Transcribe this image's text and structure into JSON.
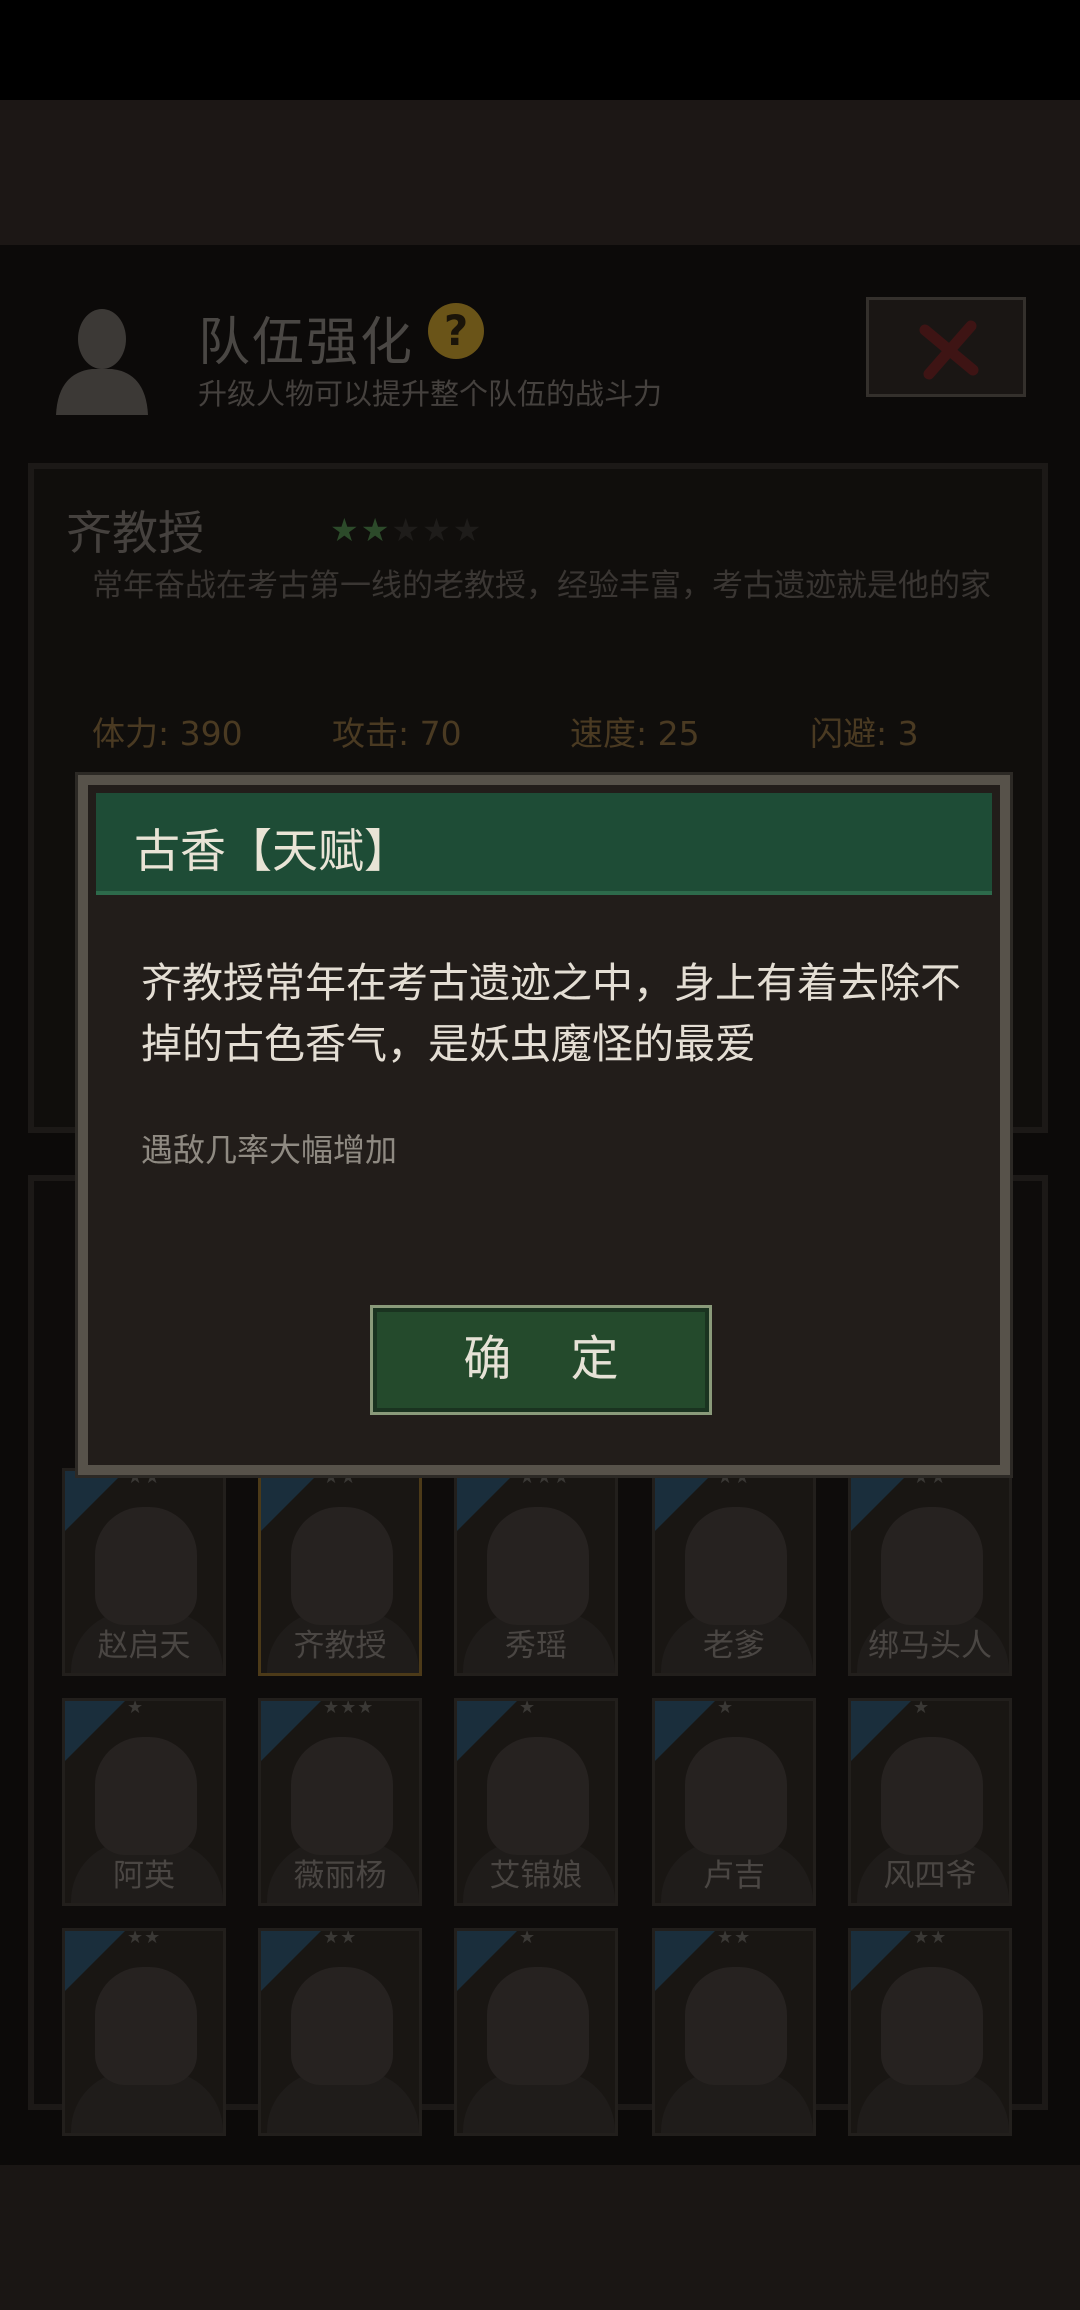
{
  "header": {
    "title": "队伍强化",
    "subtitle": "升级人物可以提升整个队伍的战斗力"
  },
  "character": {
    "name": "齐教授",
    "stars_filled": 2,
    "stars_total": 5,
    "description": "常年奋战在考古第一线的老教授，经验丰富，考古遗迹就是他的家",
    "stats": {
      "hp": "体力: 390",
      "attack": "攻击: 70",
      "speed": "速度: 25",
      "dodge": "闪避: 3"
    }
  },
  "modal": {
    "title": "古香【天赋】",
    "body": "齐教授常年在考古遗迹之中，身上有着去除不掉的古色香气，是妖虫魔怪的最爱",
    "effect": "遇敌几率大幅增加",
    "confirm_label": "确 定"
  },
  "roster": [
    {
      "name": "赵启天",
      "stars": "★★",
      "selected": false
    },
    {
      "name": "齐教授",
      "stars": "★★",
      "selected": true
    },
    {
      "name": "秀瑶",
      "stars": "★★★",
      "selected": false
    },
    {
      "name": "老爹",
      "stars": "★★",
      "selected": false
    },
    {
      "name": "绑马头人",
      "stars": "★★",
      "selected": false
    },
    {
      "name": "阿英",
      "stars": "★",
      "selected": false
    },
    {
      "name": "薇丽杨",
      "stars": "★★★",
      "selected": false
    },
    {
      "name": "艾锦娘",
      "stars": "★",
      "selected": false
    },
    {
      "name": "卢吉",
      "stars": "★",
      "selected": false
    },
    {
      "name": "风四爷",
      "stars": "★",
      "selected": false
    },
    {
      "name": "",
      "stars": "★★",
      "selected": false
    },
    {
      "name": "",
      "stars": "★★",
      "selected": false
    },
    {
      "name": "",
      "stars": "★",
      "selected": false
    },
    {
      "name": "",
      "stars": "★★",
      "selected": false
    },
    {
      "name": "",
      "stars": "★★",
      "selected": false
    }
  ]
}
